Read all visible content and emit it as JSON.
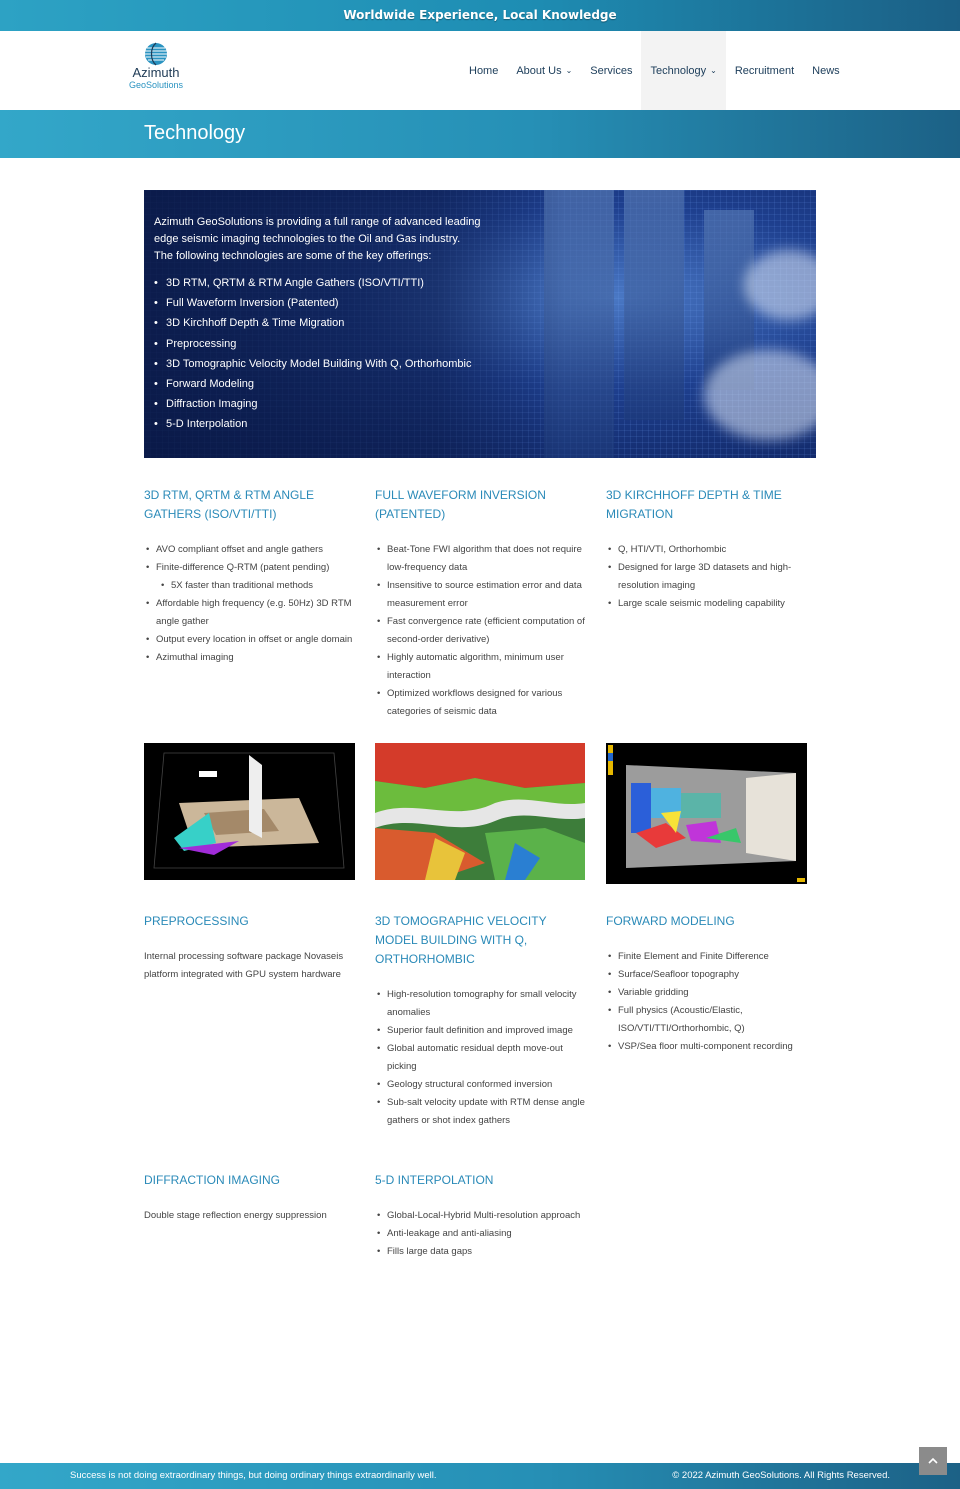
{
  "topbar": {
    "tagline": "Worldwide Experience, Local Knowledge"
  },
  "logo": {
    "name": "Azimuth",
    "sub": "GeoSolutions"
  },
  "nav": {
    "items": [
      {
        "label": "Home"
      },
      {
        "label": "About Us",
        "chevron": "⌄"
      },
      {
        "label": "Services"
      },
      {
        "label": "Technology",
        "chevron": "⌄",
        "active": true
      },
      {
        "label": "Recruitment"
      },
      {
        "label": "News"
      }
    ]
  },
  "page_title": "Technology",
  "hero": {
    "intro_1": "Azimuth GeoSolutions is providing a full range of advanced leading",
    "intro_2": "edge seismic imaging technologies to the Oil and Gas industry.",
    "intro_3": "The following technologies are some of the key offerings:",
    "items": [
      "3D RTM, QRTM & RTM Angle Gathers (ISO/VTI/TTI)",
      "Full Waveform Inversion (Patented)",
      "3D Kirchhoff Depth & Time Migration",
      "Preprocessing",
      "3D Tomographic Velocity Model Building With Q, Orthorhombic",
      "Forward Modeling",
      "Diffraction Imaging",
      "5-D Interpolation"
    ]
  },
  "sections": {
    "rtm": {
      "title": "3D RTM, QRTM & RTM Angle Gathers (ISO/VTI/TTI)",
      "items": [
        "AVO compliant offset and angle gathers",
        "Finite-difference Q-RTM (patent pending)",
        "5X faster than traditional methods",
        "Affordable high frequency (e.g. 50Hz) 3D RTM angle gather",
        "Output every location in offset or angle domain",
        "Azimuthal imaging"
      ]
    },
    "fwi": {
      "title": "Full Waveform Inversion (Patented)",
      "items": [
        "Beat-Tone FWI algorithm that does not require low-frequency data",
        "Insensitive to source estimation error and data measurement error",
        "Fast convergence rate (efficient computation of second-order derivative)",
        "Highly automatic algorithm, minimum user interaction",
        "Optimized workflows designed for various categories of seismic data"
      ]
    },
    "kirchhoff": {
      "title": "3D Kirchhoff Depth & Time Migration",
      "items": [
        "Q, HTI/VTI, Orthorhombic",
        "Designed for large 3D datasets and high-resolution imaging",
        "Large scale seismic modeling capability"
      ]
    },
    "preprocessing": {
      "title": "Preprocessing",
      "text": "Internal processing software package Novaseis platform integrated with GPU system hardware"
    },
    "tomo": {
      "title": "3D Tomographic Velocity Model Building With Q, Orthorhombic",
      "items": [
        "High-resolution tomography for small velocity anomalies",
        "Superior fault definition and improved image",
        "Global automatic residual depth move-out picking",
        "Geology structural conformed inversion",
        "Sub-salt velocity update with RTM dense angle gathers or shot index gathers"
      ]
    },
    "forward": {
      "title": "Forward Modeling",
      "items": [
        "Finite Element and Finite Difference",
        "Surface/Seafloor topography",
        "Variable gridding",
        "Full physics (Acoustic/Elastic, ISO/VTI/TTI/Orthorhombic, Q)",
        "VSP/Sea floor multi-component recording"
      ]
    },
    "diffraction": {
      "title": "Diffraction Imaging",
      "text": "Double stage reflection energy suppression"
    },
    "interp": {
      "title": "5-D Interpolation",
      "items": [
        "Global-Local-Hybrid Multi-resolution approach",
        "Anti-leakage and anti-aliasing",
        "Fills large data gaps"
      ]
    }
  },
  "footer": {
    "quote": "Success is not doing extraordinary things, but doing ordinary things extraordinarily well.",
    "copyright": "© 2022 Azimuth GeoSolutions. All Rights Reserved."
  },
  "back_to_top_icon": "chevron-up-icon"
}
